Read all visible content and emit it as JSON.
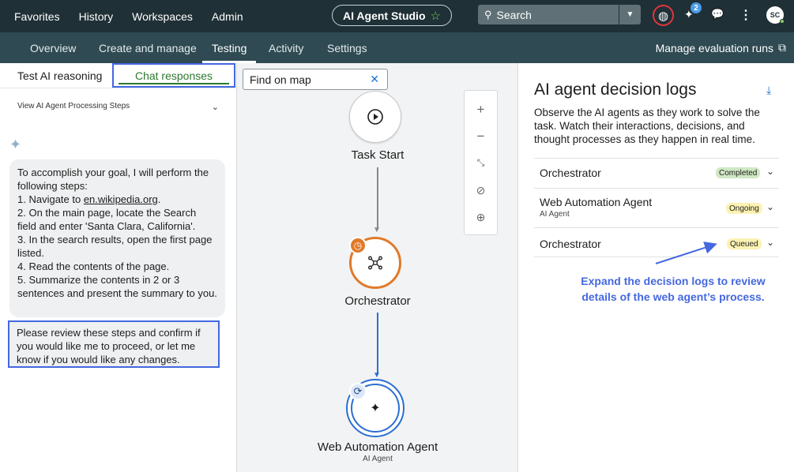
{
  "topnav": {
    "items": [
      "Favorites",
      "History",
      "Workspaces",
      "Admin"
    ],
    "app_title": "AI Agent Studio",
    "search_label": "Search",
    "notification_count": "2",
    "avatar_initials": "SC"
  },
  "subnav": {
    "tabs": [
      "Overview",
      "Create and manage",
      "Testing",
      "Activity",
      "Settings"
    ],
    "active_tab": "Testing",
    "manage_runs": "Manage evaluation runs"
  },
  "left": {
    "tab_reasoning": "Test AI reasoning",
    "tab_chat": "Chat responses",
    "processing_steps": "View AI Agent Processing Steps",
    "message_intro": "To accomplish your goal, I will perform the following steps:",
    "step1_prefix": "1. Navigate to ",
    "step1_link": "en.wikipedia.org",
    "step1_suffix": ".",
    "step2": "2. On the main page, locate the Search field and enter 'Santa Clara, California'.",
    "step3": "3. In the search results, open the first page listed.",
    "step4": "4. Read the contents of the page.",
    "step5": "5. Summarize the contents in 2 or 3 sentences and present the summary to you.",
    "confirm_message": "Please review these steps and confirm if you would like me to proceed, or let me know if you would like any changes."
  },
  "canvas": {
    "find_placeholder": "Find on map",
    "nodes": [
      {
        "label": "Task Start",
        "sub": ""
      },
      {
        "label": "Orchestrator",
        "sub": ""
      },
      {
        "label": "Web Automation Agent",
        "sub": "AI Agent"
      }
    ]
  },
  "right": {
    "title": "AI agent decision logs",
    "description": "Observe the AI agents as they work to solve the task. Watch their interactions, decisions, and thought processes as they happen in real time.",
    "logs": [
      {
        "name": "Orchestrator",
        "sub": "",
        "status": "Completed",
        "status_color": "#cfe8c4"
      },
      {
        "name": "Web Automation Agent",
        "sub": "AI Agent",
        "status": "Ongoing",
        "status_color": "#fbf2b3"
      },
      {
        "name": "Orchestrator",
        "sub": "",
        "status": "Queued",
        "status_color": "#fbf2b3"
      }
    ],
    "annotation": "Expand the decision logs to review details of the web agent’s process."
  },
  "colors": {
    "topbar": "#1f3036",
    "subbar": "#2f4a52",
    "highlight": "#4468e0",
    "orchestrator_ring": "#e07a2a",
    "agent_ring": "#2a6fd1"
  }
}
